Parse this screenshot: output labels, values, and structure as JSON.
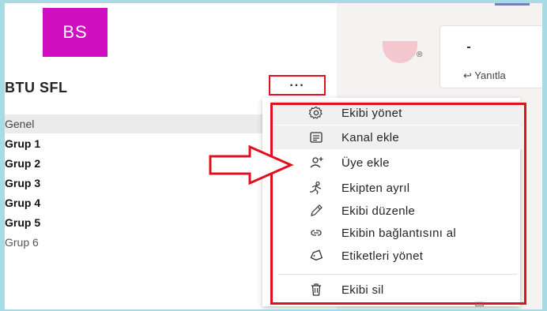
{
  "team": {
    "initials": "BS",
    "name": "BTU SFL",
    "more_label": "..."
  },
  "channels": [
    {
      "label": "Genel",
      "style": "selected"
    },
    {
      "label": "Grup 1",
      "style": "bold"
    },
    {
      "label": "Grup 2",
      "style": "bold"
    },
    {
      "label": "Grup 3",
      "style": "bold"
    },
    {
      "label": "Grup 4",
      "style": "bold"
    },
    {
      "label": "Grup 5",
      "style": "bold"
    },
    {
      "label": "Grup 6",
      "style": "normal"
    }
  ],
  "context_menu": {
    "items": [
      {
        "label": "Ekibi yönet",
        "icon": "gear-icon"
      },
      {
        "label": "Kanal ekle",
        "icon": "channel-icon"
      },
      {
        "label": "Üye ekle",
        "icon": "add-member-icon"
      },
      {
        "label": "Ekipten ayrıl",
        "icon": "leave-icon"
      },
      {
        "label": "Ekibi düzenle",
        "icon": "pencil-icon"
      },
      {
        "label": "Ekibin bağlantısını al",
        "icon": "link-icon"
      },
      {
        "label": "Etiketleri yönet",
        "icon": "tag-icon"
      },
      {
        "label": "Ekibi sil",
        "icon": "trash-icon"
      }
    ]
  },
  "chat_preview": {
    "reply_label": "Yanıtla"
  },
  "colors": {
    "avatar": "#d20fc0",
    "highlight": "#e0111e",
    "background": "#a9dbe7"
  }
}
